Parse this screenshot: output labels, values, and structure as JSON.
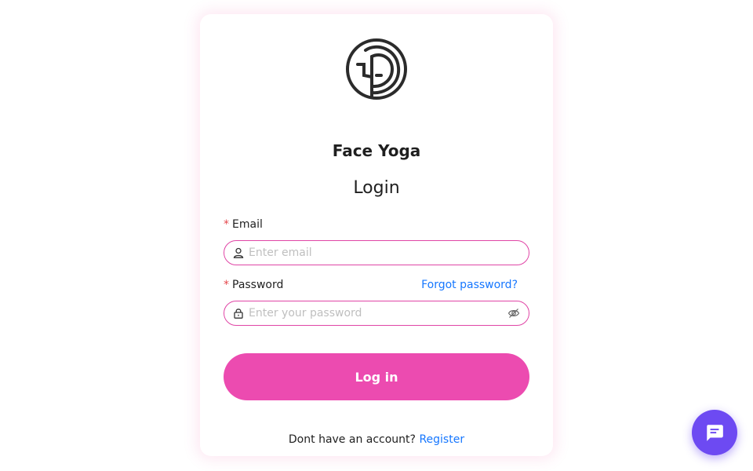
{
  "app": {
    "title": "Face Yoga"
  },
  "form": {
    "title": "Login",
    "required_mark": "*",
    "email": {
      "label": "Email",
      "placeholder": "Enter email",
      "value": ""
    },
    "password": {
      "label": "Password",
      "placeholder": "Enter your password",
      "value": ""
    },
    "forgot_label": "Forgot password?",
    "login_label": "Log in",
    "register_prompt": "Dont have an account?",
    "register_label": "Register"
  },
  "icons": {
    "logo": "face-logo-icon",
    "email": "user-icon",
    "password": "lock-icon",
    "toggle_visibility": "eye-slash-icon",
    "chat": "chat-bubble-icon"
  },
  "colors": {
    "accent": "#ec4bb0",
    "field_border": "#e045a6",
    "link": "#1677ff",
    "required": "#e5484d",
    "chat_button": "#6d4af2"
  }
}
